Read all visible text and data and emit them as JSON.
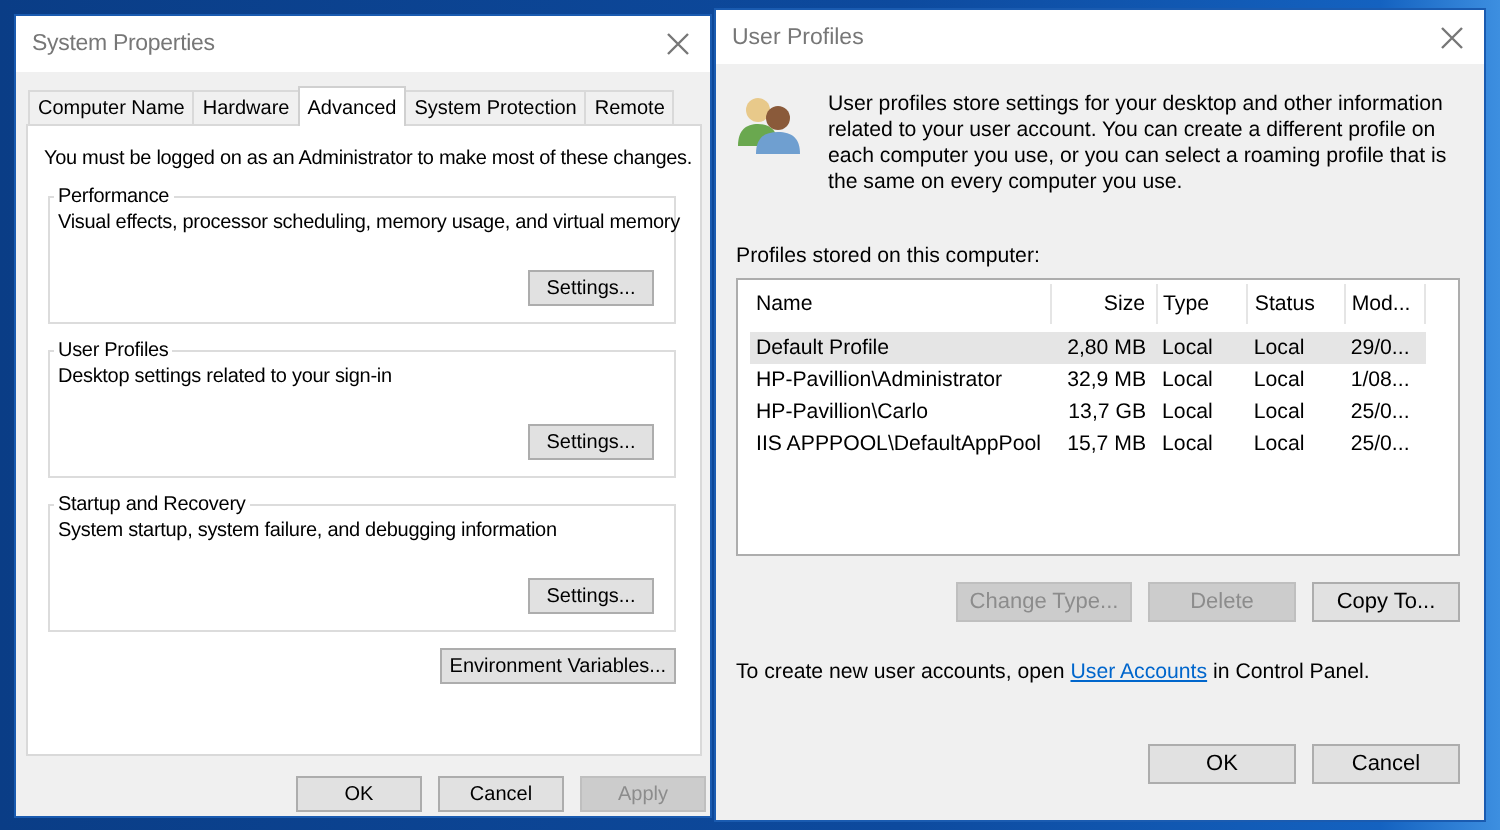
{
  "system_properties": {
    "title": "System Properties",
    "tabs": [
      {
        "label": "Computer Name",
        "selected": false
      },
      {
        "label": "Hardware",
        "selected": false
      },
      {
        "label": "Advanced",
        "selected": true
      },
      {
        "label": "System Protection",
        "selected": false
      },
      {
        "label": "Remote",
        "selected": false
      }
    ],
    "notice": "You must be logged on as an Administrator to make most of these changes.",
    "groups": [
      {
        "title": "Performance",
        "description": "Visual effects, processor scheduling, memory usage, and virtual memory",
        "button": "Settings..."
      },
      {
        "title": "User Profiles",
        "description": "Desktop settings related to your sign-in",
        "button": "Settings..."
      },
      {
        "title": "Startup and Recovery",
        "description": "System startup, system failure, and debugging information",
        "button": "Settings..."
      }
    ],
    "environment_button": "Environment Variables...",
    "buttons": [
      {
        "label": "OK",
        "disabled": false
      },
      {
        "label": "Cancel",
        "disabled": false
      },
      {
        "label": "Apply",
        "disabled": true
      }
    ]
  },
  "user_profiles": {
    "title": "User Profiles",
    "description": "User profiles store settings for your desktop and other information related to your user account. You can create a different profile on each computer you use, or you can select a roaming profile that is the same on every computer you use.",
    "list_label": "Profiles stored on this computer:",
    "columns": [
      "Name",
      "Size",
      "Type",
      "Status",
      "Mod..."
    ],
    "rows": [
      {
        "cells": [
          "Default Profile",
          "2,80 MB",
          "Local",
          "Local",
          "29/0..."
        ],
        "selected": true
      },
      {
        "cells": [
          "HP-Pavillion\\Administrator",
          "32,9 MB",
          "Local",
          "Local",
          "1/08..."
        ],
        "selected": false
      },
      {
        "cells": [
          "HP-Pavillion\\Carlo",
          "13,7 GB",
          "Local",
          "Local",
          "25/0..."
        ],
        "selected": false
      },
      {
        "cells": [
          "IIS APPPOOL\\DefaultAppPool",
          "15,7 MB",
          "Local",
          "Local",
          "25/0..."
        ],
        "selected": false
      }
    ],
    "actions": [
      {
        "label": "Change Type...",
        "disabled": true
      },
      {
        "label": "Delete",
        "disabled": true
      },
      {
        "label": "Copy To...",
        "disabled": false
      }
    ],
    "footer": {
      "before": "To create new user accounts, open ",
      "link": "User Accounts",
      "after": " in Control Panel."
    },
    "buttons": [
      {
        "label": "OK",
        "disabled": false
      },
      {
        "label": "Cancel",
        "disabled": false
      }
    ]
  }
}
